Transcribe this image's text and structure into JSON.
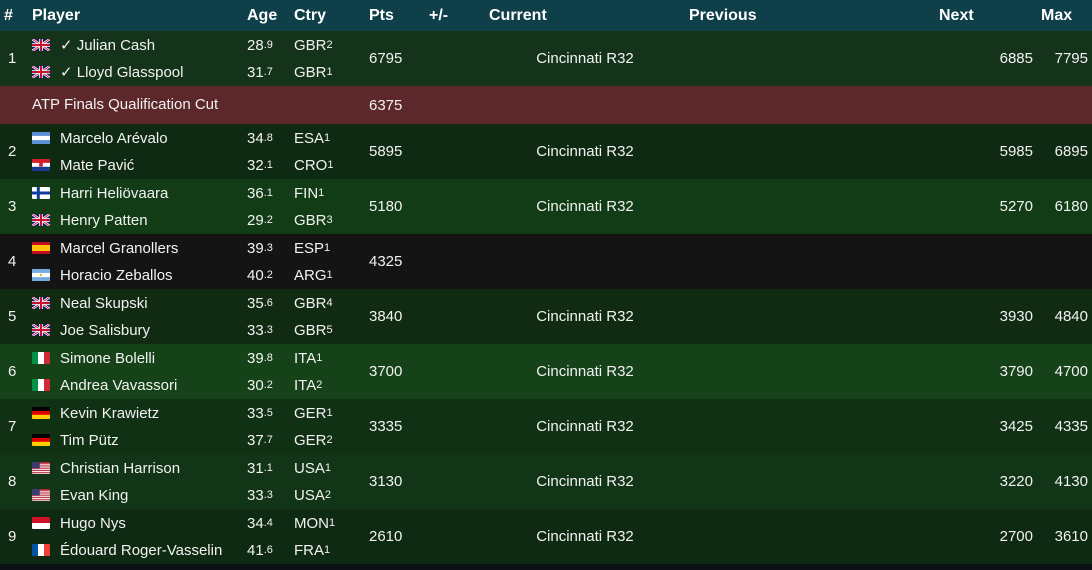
{
  "header": {
    "rank": "#",
    "player": "Player",
    "age": "Age",
    "ctry": "Ctry",
    "pts": "Pts",
    "change": "+/-",
    "current": "Current",
    "previous": "Previous",
    "next": "Next",
    "max": "Max"
  },
  "cut": {
    "label": "ATP Finals Qualification Cut",
    "pts": "6375"
  },
  "teams": [
    {
      "rank": "1",
      "pts": "6795",
      "current": "Cincinnati R32",
      "next": "6885",
      "max": "7795",
      "players": [
        {
          "name": "✓ Julian Cash",
          "age": "28",
          "age_dec": ".9",
          "ctry": "GBR",
          "ctry_rank": "2",
          "flag": "gb"
        },
        {
          "name": "✓ Lloyd Glasspool",
          "age": "31",
          "age_dec": ".7",
          "ctry": "GBR",
          "ctry_rank": "1",
          "flag": "gb"
        }
      ]
    },
    {
      "rank": "2",
      "pts": "5895",
      "current": "Cincinnati R32",
      "next": "5985",
      "max": "6895",
      "players": [
        {
          "name": "Marcelo Arévalo",
          "age": "34",
          "age_dec": ".8",
          "ctry": "ESA",
          "ctry_rank": "1",
          "flag": "sv"
        },
        {
          "name": "Mate Pavić",
          "age": "32",
          "age_dec": ".1",
          "ctry": "CRO",
          "ctry_rank": "1",
          "flag": "hr"
        }
      ]
    },
    {
      "rank": "3",
      "pts": "5180",
      "current": "Cincinnati R32",
      "next": "5270",
      "max": "6180",
      "players": [
        {
          "name": "Harri Heliövaara",
          "age": "36",
          "age_dec": ".1",
          "ctry": "FIN",
          "ctry_rank": "1",
          "flag": "fi"
        },
        {
          "name": "Henry Patten",
          "age": "29",
          "age_dec": ".2",
          "ctry": "GBR",
          "ctry_rank": "3",
          "flag": "gb"
        }
      ]
    },
    {
      "rank": "4",
      "pts": "4325",
      "current": "",
      "next": "",
      "max": "",
      "players": [
        {
          "name": "Marcel Granollers",
          "age": "39",
          "age_dec": ".3",
          "ctry": "ESP",
          "ctry_rank": "1",
          "flag": "es"
        },
        {
          "name": "Horacio Zeballos",
          "age": "40",
          "age_dec": ".2",
          "ctry": "ARG",
          "ctry_rank": "1",
          "flag": "ar"
        }
      ]
    },
    {
      "rank": "5",
      "pts": "3840",
      "current": "Cincinnati R32",
      "next": "3930",
      "max": "4840",
      "players": [
        {
          "name": "Neal Skupski",
          "age": "35",
          "age_dec": ".6",
          "ctry": "GBR",
          "ctry_rank": "4",
          "flag": "gb"
        },
        {
          "name": "Joe Salisbury",
          "age": "33",
          "age_dec": ".3",
          "ctry": "GBR",
          "ctry_rank": "5",
          "flag": "gb"
        }
      ]
    },
    {
      "rank": "6",
      "pts": "3700",
      "current": "Cincinnati R32",
      "next": "3790",
      "max": "4700",
      "players": [
        {
          "name": "Simone Bolelli",
          "age": "39",
          "age_dec": ".8",
          "ctry": "ITA",
          "ctry_rank": "1",
          "flag": "it"
        },
        {
          "name": "Andrea Vavassori",
          "age": "30",
          "age_dec": ".2",
          "ctry": "ITA",
          "ctry_rank": "2",
          "flag": "it"
        }
      ]
    },
    {
      "rank": "7",
      "pts": "3335",
      "current": "Cincinnati R32",
      "next": "3425",
      "max": "4335",
      "players": [
        {
          "name": "Kevin Krawietz",
          "age": "33",
          "age_dec": ".5",
          "ctry": "GER",
          "ctry_rank": "1",
          "flag": "de"
        },
        {
          "name": "Tim Pütz",
          "age": "37",
          "age_dec": ".7",
          "ctry": "GER",
          "ctry_rank": "2",
          "flag": "de"
        }
      ]
    },
    {
      "rank": "8",
      "pts": "3130",
      "current": "Cincinnati R32",
      "next": "3220",
      "max": "4130",
      "players": [
        {
          "name": "Christian Harrison",
          "age": "31",
          "age_dec": ".1",
          "ctry": "USA",
          "ctry_rank": "1",
          "flag": "us"
        },
        {
          "name": "Evan King",
          "age": "33",
          "age_dec": ".3",
          "ctry": "USA",
          "ctry_rank": "2",
          "flag": "us"
        }
      ]
    },
    {
      "rank": "9",
      "pts": "2610",
      "current": "Cincinnati R32",
      "next": "2700",
      "max": "3610",
      "players": [
        {
          "name": "Hugo Nys",
          "age": "34",
          "age_dec": ".4",
          "ctry": "MON",
          "ctry_rank": "1",
          "flag": "mc"
        },
        {
          "name": "Édouard Roger-Vasselin",
          "age": "41",
          "age_dec": ".6",
          "ctry": "FRA",
          "ctry_rank": "1",
          "flag": "fr"
        }
      ]
    }
  ]
}
